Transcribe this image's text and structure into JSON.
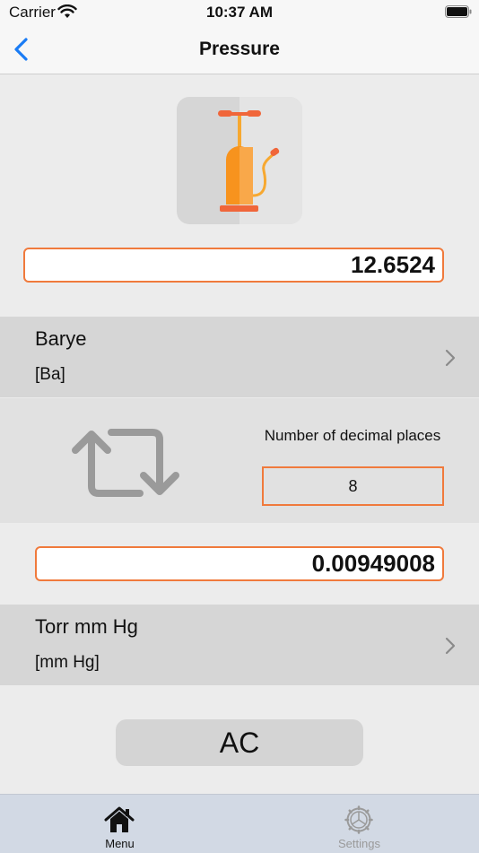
{
  "status_bar": {
    "carrier": "Carrier",
    "time": "10:37 AM"
  },
  "nav": {
    "title": "Pressure",
    "back_icon": "chevron-left-icon"
  },
  "converter": {
    "input_value": "12.6524",
    "from_unit": {
      "name": "Barye",
      "symbol": "[Ba]"
    },
    "decimals_label": "Number of decimal places",
    "decimals_value": "8",
    "output_value": "0.00949008",
    "to_unit": {
      "name": "Torr mm Hg",
      "symbol": "[mm Hg]"
    },
    "clear_label": "AC"
  },
  "tab_bar": {
    "tabs": [
      {
        "label": "Menu",
        "icon": "home-icon",
        "selected": true
      },
      {
        "label": "Settings",
        "icon": "gear-icon",
        "selected": false
      }
    ]
  },
  "colors": {
    "accent": "#f07a3c",
    "nav_blue": "#1a7cf5",
    "pump_orange": "#f7931e"
  }
}
